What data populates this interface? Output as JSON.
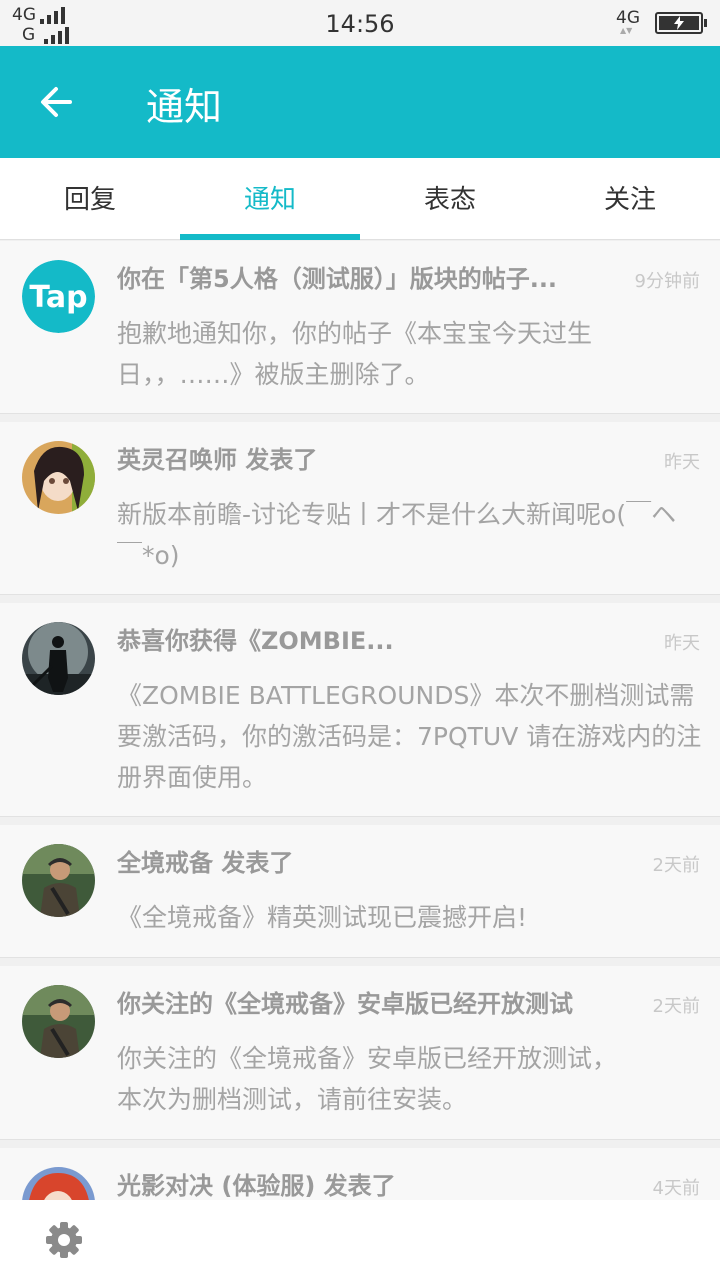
{
  "status": {
    "net_left_top": "4G",
    "net_left_bottom": "G",
    "time": "14:56",
    "net_right": "4G"
  },
  "header": {
    "title": "通知",
    "back_icon": "arrow-left-icon"
  },
  "tabs": [
    {
      "label": "回复",
      "active": false
    },
    {
      "label": "通知",
      "active": true
    },
    {
      "label": "表态",
      "active": false
    },
    {
      "label": "关注",
      "active": false
    }
  ],
  "notifications": [
    {
      "title": "你在「第5人格（测试服）」版块的帖子...",
      "time": "9分钟前",
      "body": "抱歉地通知你，你的帖子《本宝宝今天过生日，，……》被版主删除了。",
      "avatar": "tap-logo"
    },
    {
      "title": "英灵召唤师 发表了",
      "time": "昨天",
      "body": "新版本前瞻-讨论专贴丨才不是什么大新闻呢o(￣ヘ￣*o)",
      "avatar": "anime-girl"
    },
    {
      "title": "恭喜你获得《ZOMBIE...",
      "time": "昨天",
      "body": "《ZOMBIE BATTLEGROUNDS》本次不删档测试需要激活码，你的激活码是：7PQTUV 请在游戏内的注册界面使用。",
      "avatar": "zombie-survivor"
    },
    {
      "title": "全境戒备 发表了",
      "time": "2天前",
      "body": "《全境戒备》精英测试现已震撼开启!",
      "avatar": "soldier"
    },
    {
      "title": "你关注的《全境戒备》安卓版已经开放测试",
      "time": "2天前",
      "body": "你关注的《全境戒备》安卓版已经开放测试，本次为删档测试，请前往安装。",
      "avatar": "soldier"
    },
    {
      "title": "光影对决 (体验服) 发表了",
      "time": "4天前",
      "body": "",
      "avatar": "anime-red-hair"
    }
  ],
  "bottom": {
    "settings_icon": "gear-icon"
  },
  "colors": {
    "accent": "#14bac8"
  }
}
